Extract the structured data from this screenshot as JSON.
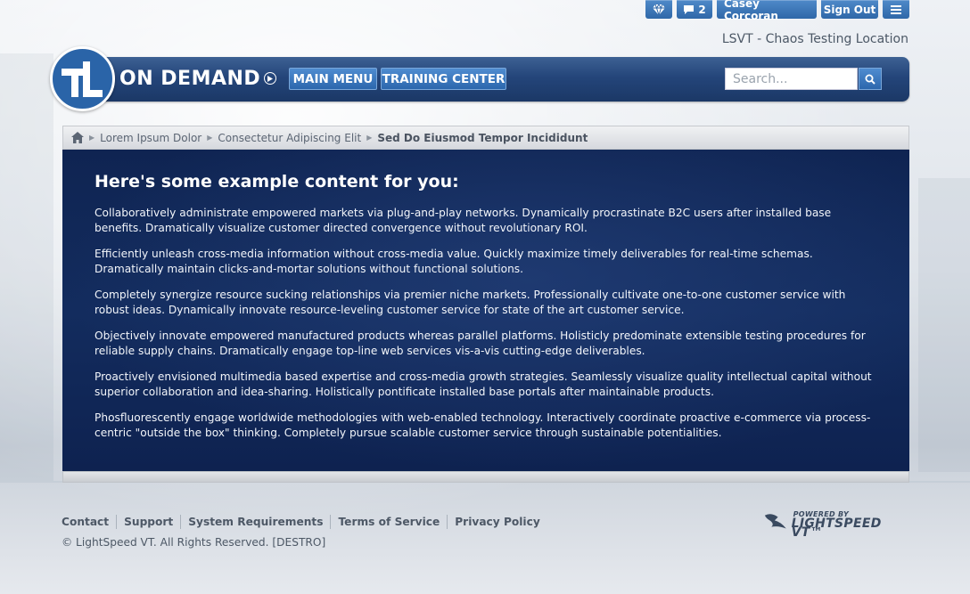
{
  "topbar": {
    "icon_name": "diamond-icon",
    "messages_icon": "chat-bubble-icon",
    "messages_count": "2",
    "user_name": "Casey Corcoran",
    "signout_label": "Sign Out",
    "menu_icon": "hamburger-menu-icon"
  },
  "location": "LSVT - Chaos Testing Location",
  "logo": {
    "mark": "TL",
    "text": "ON DEMAND",
    "play_icon": "play-circle-icon"
  },
  "nav": {
    "main_menu": "MAIN MENU",
    "training_center": "TRAINING CENTER"
  },
  "search": {
    "placeholder": "Search...",
    "icon": "search-icon"
  },
  "breadcrumb": {
    "home_icon": "home-icon",
    "items": [
      "Lorem Ipsum Dolor",
      "Consectetur Adipiscing Elit"
    ],
    "current": "Sed Do Eiusmod Tempor Incididunt"
  },
  "content": {
    "heading": "Here's some example content for you:",
    "paragraphs": [
      "Collaboratively administrate empowered markets via plug-and-play networks. Dynamically procrastinate B2C users after installed base benefits. Dramatically visualize customer directed convergence without revolutionary ROI.",
      "Efficiently unleash cross-media information without cross-media value. Quickly maximize timely deliverables for real-time schemas. Dramatically maintain clicks-and-mortar solutions without functional solutions.",
      "Completely synergize resource sucking relationships via premier niche markets. Professionally cultivate one-to-one customer service with robust ideas. Dynamically innovate resource-leveling customer service for state of the art customer service.",
      "Objectively innovate empowered manufactured products whereas parallel platforms. Holisticly predominate extensible testing procedures for reliable supply chains. Dramatically engage top-line web services vis-a-vis cutting-edge deliverables.",
      "Proactively envisioned multimedia based expertise and cross-media growth strategies. Seamlessly visualize quality intellectual capital without superior collaboration and idea-sharing. Holistically pontificate installed base portals after maintainable products.",
      "Phosfluorescently engage worldwide methodologies with web-enabled technology. Interactively coordinate proactive e-commerce via process-centric \"outside the box\" thinking. Completely pursue scalable customer service through sustainable potentialities."
    ]
  },
  "footer": {
    "links": [
      "Contact",
      "Support",
      "System Requirements",
      "Terms of Service",
      "Privacy Policy"
    ],
    "copyright": "© LightSpeed VT. All Rights Reserved. [DESTRO]",
    "powered_small": "POWERED BY",
    "powered_big": "LIGHTSPEED VT™"
  },
  "colors": {
    "header_blue": "#24457a",
    "button_blue": "#2f67a8",
    "panel_navy": "#132c5e"
  }
}
